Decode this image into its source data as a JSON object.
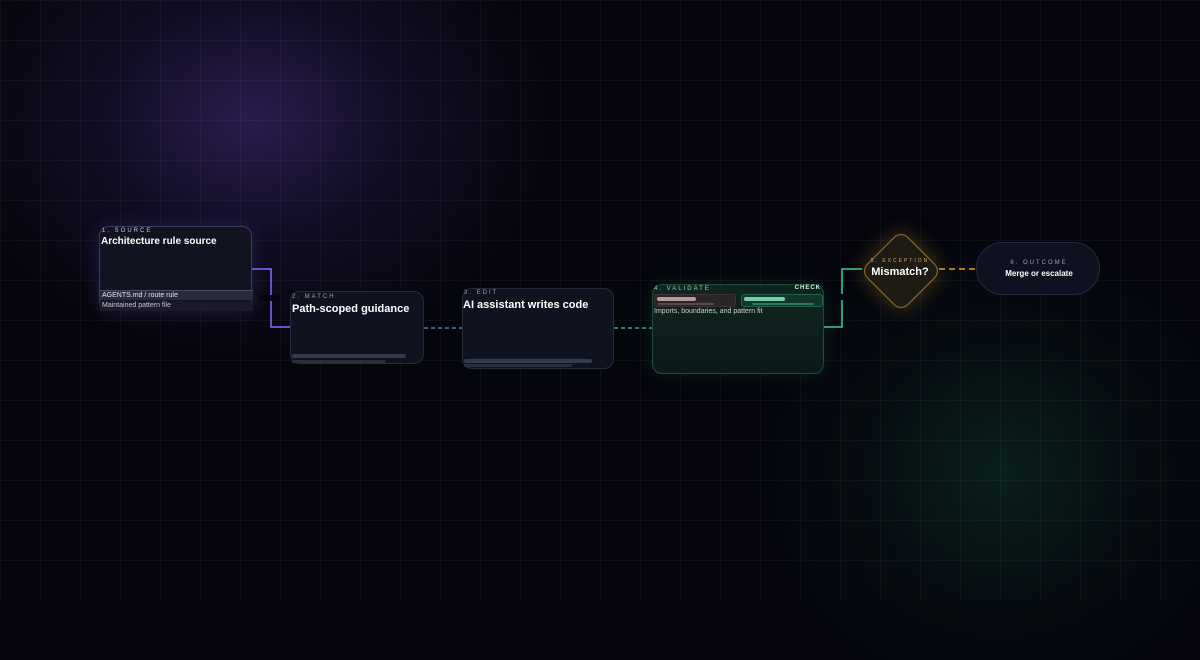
{
  "colors": {
    "background": "#05060d",
    "purple_accent": "#8f68ff",
    "pink_dashed": "#ff5e8e",
    "blue_accent": "#4f8df0",
    "teal_accent": "#3ccf95",
    "amber_accent": "#e39b2c"
  },
  "nodes": {
    "source": {
      "step": "1. SOURCE",
      "title": "Architecture rule source",
      "items": [
        "AGENTS.md / route rule",
        "Maintained pattern file"
      ]
    },
    "match": {
      "step": "2. MATCH",
      "title": "Path-scoped guidance"
    },
    "edit": {
      "step": "3. EDIT",
      "title": "AI assistant writes code"
    },
    "validate": {
      "step": "4. VALIDATE",
      "badge": "CHECK",
      "description": "Imports, boundaries, and pattern fit",
      "meters": [
        {
          "name": "meter-a",
          "level": 0.5
        },
        {
          "name": "meter-b",
          "level": 0.52
        }
      ]
    },
    "exception": {
      "step": "5. EXCEPTION",
      "title": "Mismatch?"
    },
    "outcome": {
      "step": "6. OUTCOME",
      "title": "Merge or escalate"
    }
  }
}
